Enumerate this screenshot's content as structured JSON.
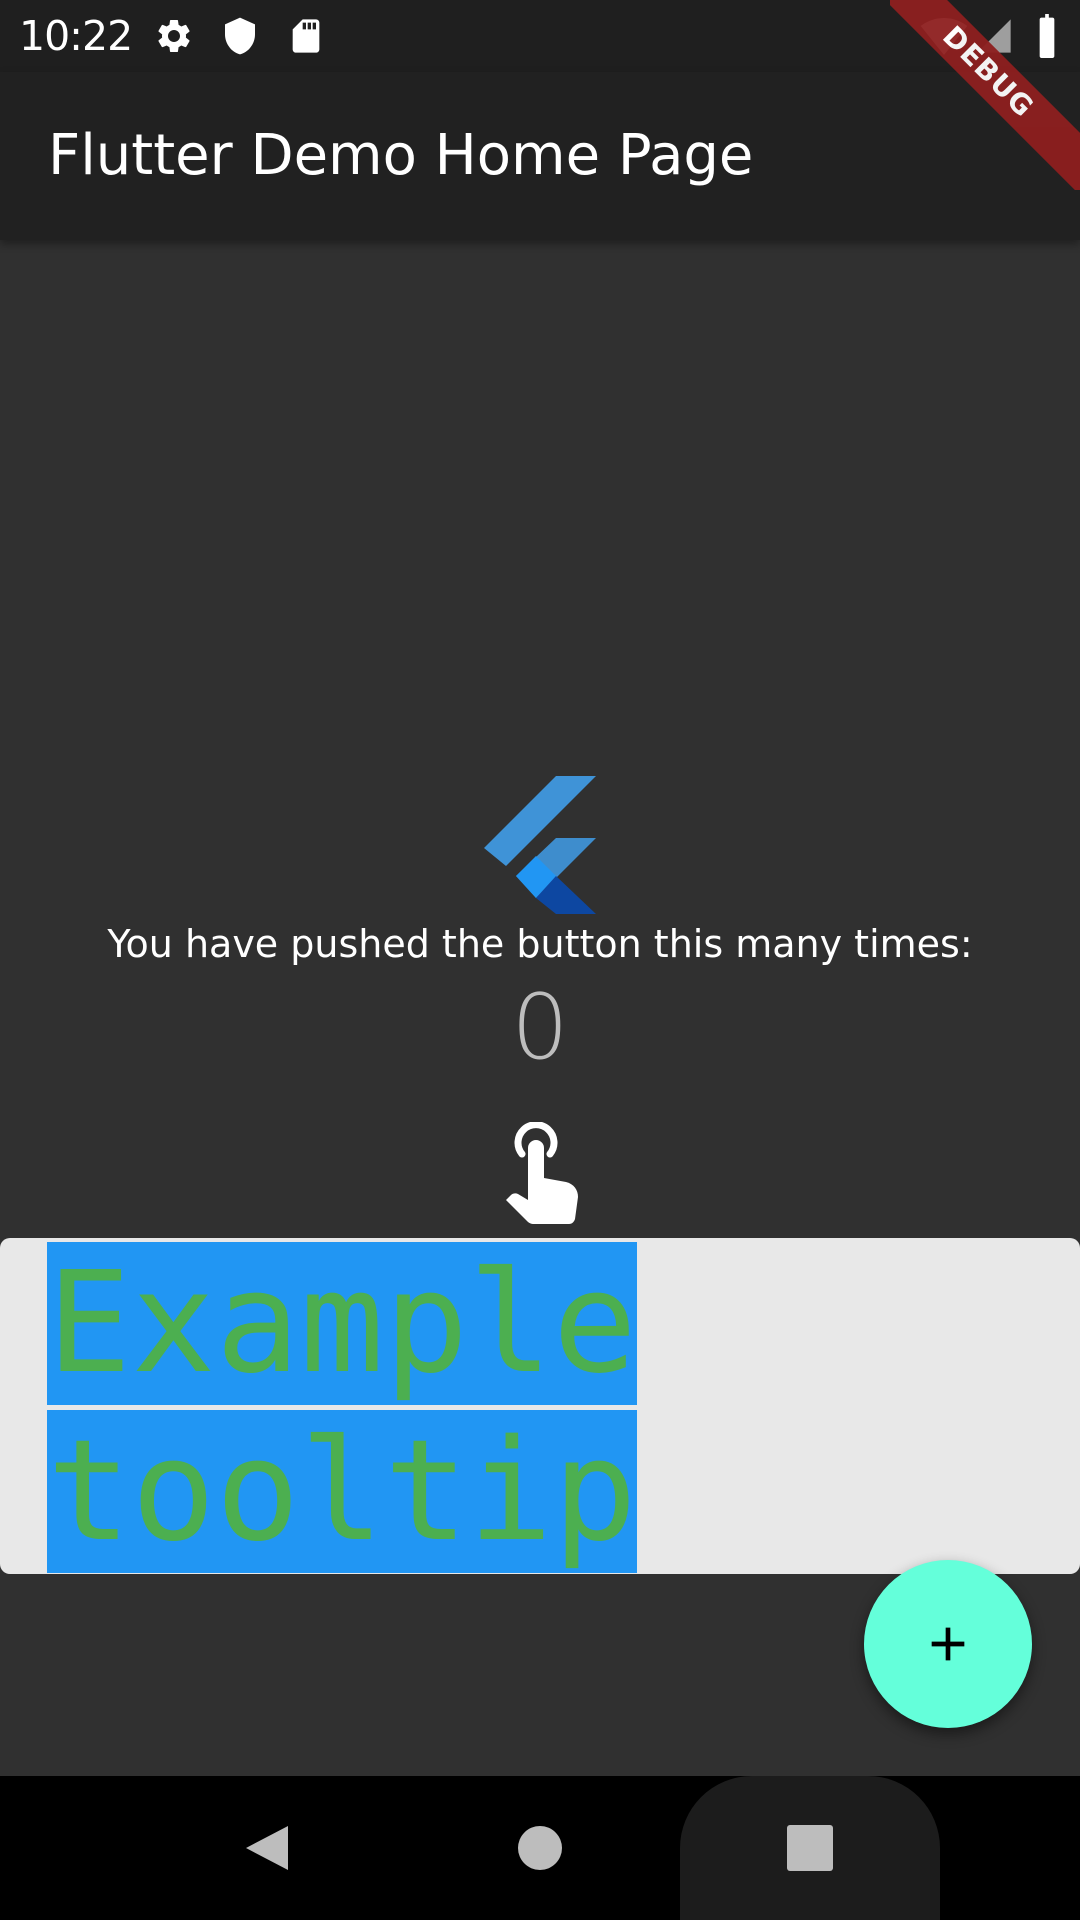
{
  "status_bar": {
    "time": "10:22",
    "left_icons": [
      "gear-icon",
      "shield-icon",
      "sd-card-icon"
    ],
    "right_icons": [
      "wifi-icon",
      "cell-signal-icon",
      "battery-icon"
    ]
  },
  "debug_banner": {
    "label": "DEBUG",
    "color": "#8e1f1f"
  },
  "app_bar": {
    "title": "Flutter Demo Home Page"
  },
  "main": {
    "caption": "You have pushed the button this many times:",
    "counter": "0",
    "logo": "flutter-logo",
    "tap_icon": "touch-app-icon"
  },
  "tooltip": {
    "line1": "Example",
    "line2": "tooltip",
    "text_color": "#4caf50",
    "highlight_color": "#2196f3",
    "background": "#e8e8e8"
  },
  "fab": {
    "icon": "plus-icon",
    "color": "#64ffda"
  },
  "nav_bar": {
    "buttons": [
      "back-icon",
      "home-icon",
      "recents-icon"
    ]
  }
}
